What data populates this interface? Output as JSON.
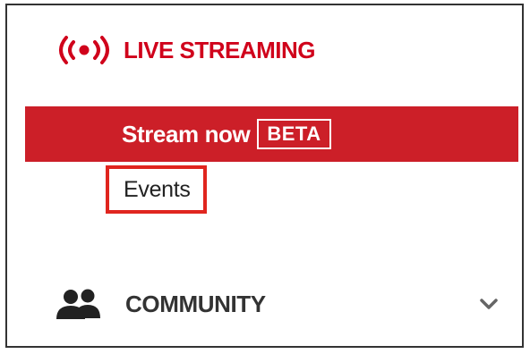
{
  "sections": {
    "live_streaming": {
      "icon": "live-broadcast-icon",
      "title": "LIVE STREAMING",
      "items": [
        {
          "label": "Stream now",
          "badge": "BETA",
          "selected": true
        },
        {
          "label": "Events",
          "highlighted": true
        }
      ]
    },
    "community": {
      "icon": "people-icon",
      "title": "COMMUNITY",
      "expand_icon": "chevron-down-icon"
    }
  },
  "colors": {
    "accent_red": "#cc1f28",
    "highlight_border": "#e0251f",
    "text_dark": "#333333"
  }
}
